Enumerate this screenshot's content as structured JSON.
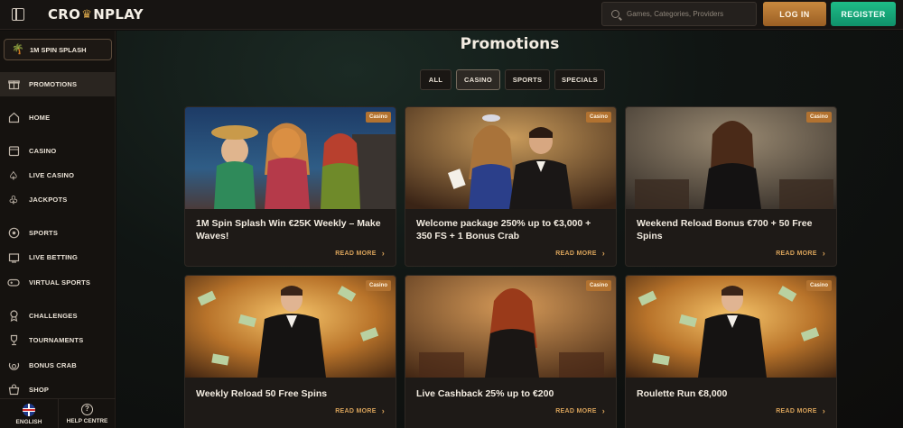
{
  "header": {
    "brand": {
      "pre": "CRO",
      "post": "NPLAY"
    },
    "search_placeholder": "Games, Categories, Providers",
    "login_label": "LOG IN",
    "register_label": "REGISTER"
  },
  "sidebar": {
    "banner": "1M SPIN SPLASH",
    "items": [
      {
        "label": "PROMOTIONS",
        "icon": "gift-icon"
      },
      {
        "label": "HOME",
        "icon": "home-icon"
      },
      {
        "label": "CASINO",
        "icon": "slot-machine-icon"
      },
      {
        "label": "LIVE CASINO",
        "icon": "spade-icon"
      },
      {
        "label": "JACKPOTS",
        "icon": "clover-icon"
      },
      {
        "label": "SPORTS",
        "icon": "soccer-ball-icon"
      },
      {
        "label": "LIVE BETTING",
        "icon": "live-betting-icon"
      },
      {
        "label": "VIRTUAL SPORTS",
        "icon": "gamepad-icon"
      },
      {
        "label": "CHALLENGES",
        "icon": "medal-icon"
      },
      {
        "label": "TOURNAMENTS",
        "icon": "trophy-icon"
      },
      {
        "label": "BONUS CRAB",
        "icon": "crab-icon"
      },
      {
        "label": "SHOP",
        "icon": "shop-icon"
      }
    ],
    "footer": {
      "language": "ENGLISH",
      "help": "HELP CENTRE"
    }
  },
  "main": {
    "title": "Promotions",
    "filters": [
      "ALL",
      "CASINO",
      "SPORTS",
      "SPECIALS"
    ],
    "active_filter": "CASINO",
    "read_more": "READ MORE",
    "cards": [
      {
        "badge": "Casino",
        "title": "1M Spin Splash Win €25K Weekly – Make Waves!"
      },
      {
        "badge": "Casino",
        "title": "Welcome package 250% up to €3,000 + 350 FS + 1 Bonus Crab"
      },
      {
        "badge": "Casino",
        "title": "Weekend Reload Bonus €700 + 50 Free Spins"
      },
      {
        "badge": "Casino",
        "title": "Weekly Reload 50 Free Spins"
      },
      {
        "badge": "Casino",
        "title": "Live Cashback 25% up to €200"
      },
      {
        "badge": "Casino",
        "title": "Roulette Run €8,000"
      }
    ]
  },
  "colors": {
    "accent_gold": "#c9893e",
    "register_green": "#1ebc87",
    "badge_orange": "#b27230",
    "read_more": "#d8a25a"
  }
}
